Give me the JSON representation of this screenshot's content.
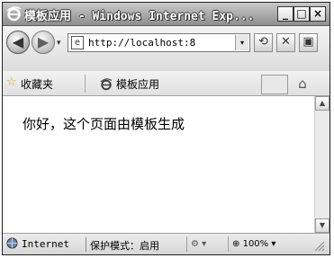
{
  "window": {
    "title": "模板应用 - Windows Internet Exp...",
    "minimize_label": "_",
    "maximize_label": "□",
    "close_label": "×"
  },
  "address_bar": {
    "back_glyph": "◀",
    "forward_glyph": "▶",
    "dropdown_glyph": "▾",
    "url": "http://localhost:8",
    "url_dropdown_glyph": "▾",
    "refresh_glyph": "⟲",
    "stop_glyph": "✕",
    "extra_glyph": "▣"
  },
  "favorites_bar": {
    "favorites_label": "收藏夹",
    "tab_title": "模板应用",
    "home_glyph": "⌂"
  },
  "content": {
    "text": "你好，这个页面由模板生成"
  },
  "scrollbar": {
    "up_glyph": "▲",
    "down_glyph": "▼"
  },
  "status_bar": {
    "zone": "Internet",
    "protected_mode": "保护模式：启用",
    "zone_settings_glyph": "⚙ ▾",
    "zoom": "100%",
    "zoom_dropdown_glyph": "▾"
  },
  "colors": {
    "title_gradient_top": "#c9c9c9",
    "title_gradient_bottom": "#8e8e8e",
    "content_bg": "#ffffff"
  }
}
